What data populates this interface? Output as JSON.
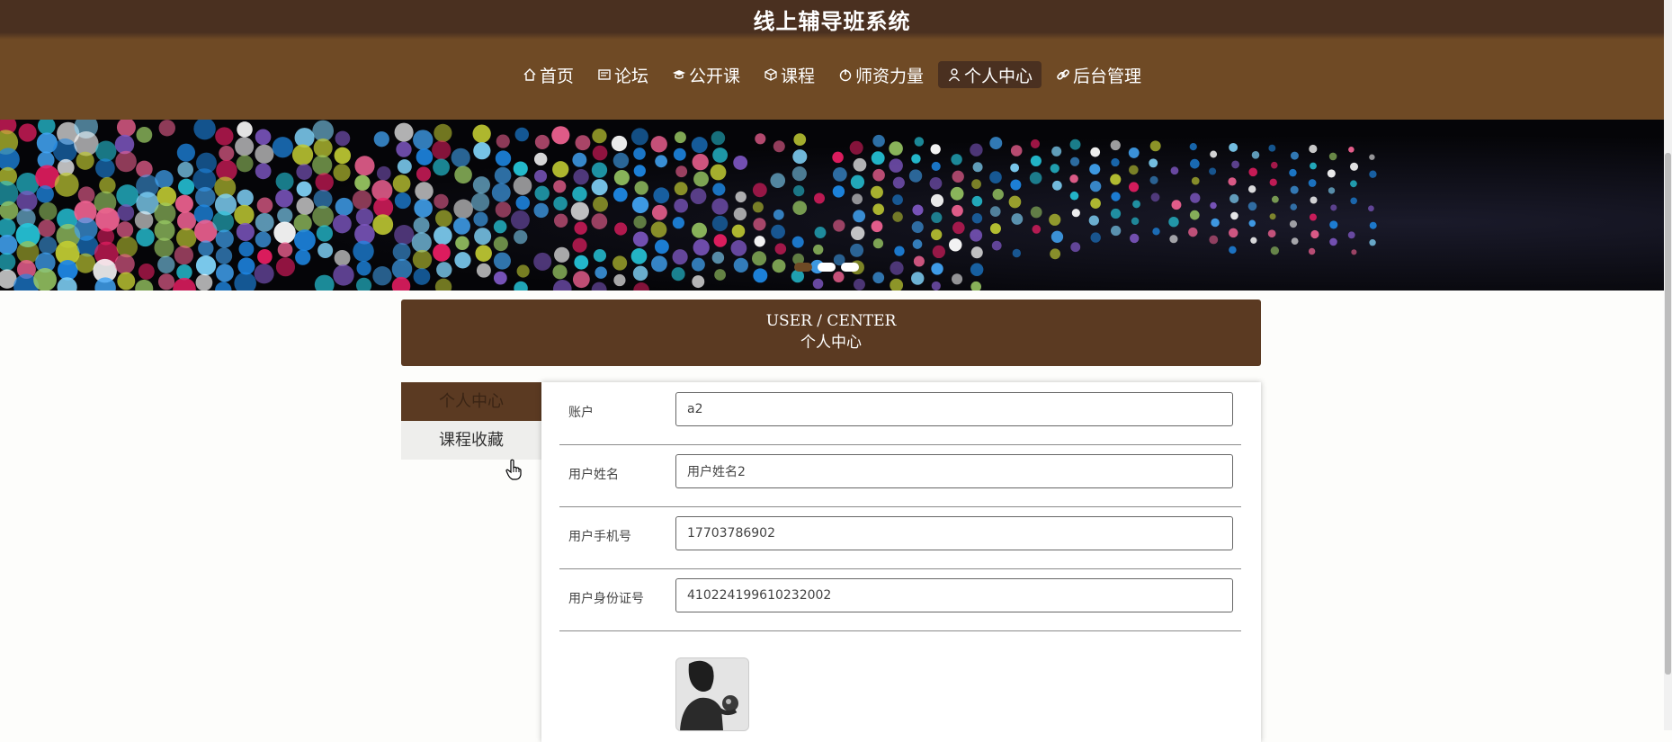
{
  "site": {
    "title": "线上辅导班系统"
  },
  "nav": [
    {
      "icon": "home-icon",
      "label": "首页"
    },
    {
      "icon": "forum-icon",
      "label": "论坛"
    },
    {
      "icon": "open-course-icon",
      "label": "公开课"
    },
    {
      "icon": "course-icon",
      "label": "课程"
    },
    {
      "icon": "teacher-icon",
      "label": "师资力量"
    },
    {
      "icon": "user-icon",
      "label": "个人中心",
      "active": true
    },
    {
      "icon": "link-icon",
      "label": "后台管理"
    }
  ],
  "banner": {
    "slides": 3,
    "active_slide": 1
  },
  "section": {
    "title_en": "USER / CENTER",
    "title_cn": "个人中心"
  },
  "side_menu": [
    {
      "label": "个人中心",
      "active": true
    },
    {
      "label": "课程收藏",
      "active": false
    }
  ],
  "form": {
    "fields": [
      {
        "label": "账户",
        "value": "a2"
      },
      {
        "label": "用户姓名",
        "value": "用户姓名2"
      },
      {
        "label": "用户手机号",
        "value": "17703786902"
      },
      {
        "label": "用户身份证号",
        "value": "410224199610232002"
      }
    ],
    "avatar_icon": "user-photo"
  },
  "colors": {
    "header": "#6f4a25",
    "header_dark": "#4a3020",
    "accent": "#5b3a22"
  }
}
